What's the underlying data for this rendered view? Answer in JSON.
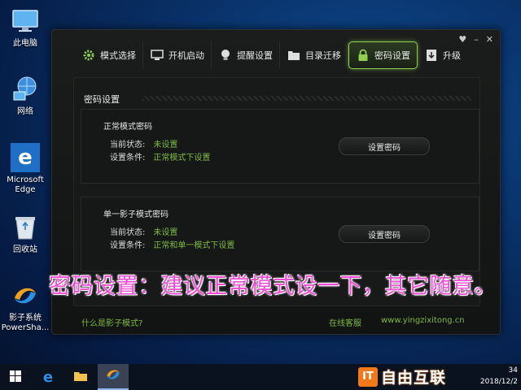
{
  "desktop": {
    "icons": [
      {
        "label": "此电脑",
        "icon": "this-pc-icon"
      },
      {
        "label": "网络",
        "icon": "network-icon"
      },
      {
        "label": "Microsoft Edge",
        "icon": "edge-icon"
      },
      {
        "label": "回收站",
        "icon": "recycle-bin-icon"
      },
      {
        "label": "影子系统 PowerSha...",
        "icon": "powershadow-icon"
      }
    ]
  },
  "window": {
    "controls": {
      "menu": "♥",
      "minimize": "–",
      "close": "✕"
    },
    "tabs": [
      {
        "label": "模式选择",
        "icon": "gear-icon",
        "active": false
      },
      {
        "label": "开机启动",
        "icon": "monitor-icon",
        "active": false
      },
      {
        "label": "提醒设置",
        "icon": "bulb-icon",
        "active": false
      },
      {
        "label": "目录迁移",
        "icon": "folder-icon",
        "active": false
      },
      {
        "label": "密码设置",
        "icon": "lock-icon",
        "active": true
      },
      {
        "label": "升级",
        "icon": "upgrade-icon",
        "active": false
      }
    ],
    "panel": {
      "title": "密码设置",
      "normal": {
        "title": "正常模式密码",
        "status_key": "当前状态:",
        "status_value": "未设置",
        "cond_key": "设置条件:",
        "cond_value": "正常模式下设置",
        "button": "设置密码"
      },
      "single": {
        "title": "单一影子模式密码",
        "status_key": "当前状态:",
        "status_value": "未设置",
        "cond_key": "设置条件:",
        "cond_value": "正常和单一模式下设置",
        "button": "设置密码"
      }
    },
    "footer": {
      "help_link": "什么是影子模式?",
      "support_link": "在线客服",
      "website": "www.yingzixitong.cn"
    }
  },
  "caption": "密码设置：建议正常模式设一下，其它随意。",
  "taskbar": {
    "items": [
      "start-icon",
      "edge-icon",
      "explorer-icon",
      "powershadow-icon"
    ],
    "time": "34",
    "date": "2018/12/2"
  },
  "watermark": {
    "badge": "IT",
    "text": "自由互联"
  },
  "colors": {
    "accent_green": "#7fba3c",
    "caption_pink": "#f04bd6",
    "tab_active_border": "#8fd14f"
  }
}
